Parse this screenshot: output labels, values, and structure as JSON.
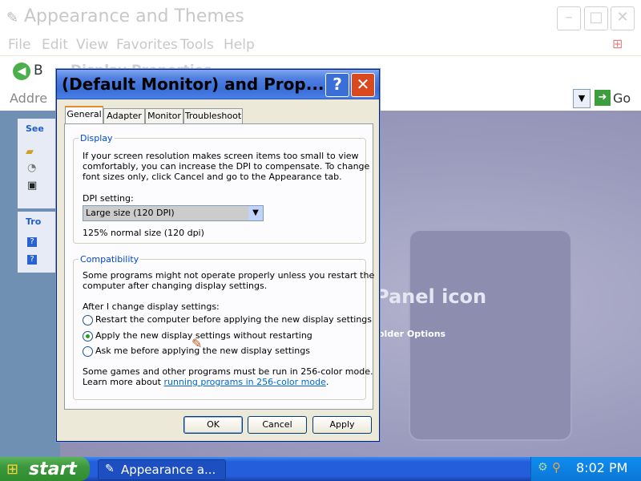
{
  "explorer": {
    "title": "Appearance and Themes",
    "menu": [
      "File",
      "Edit",
      "View",
      "Favorites",
      "Tools",
      "Help"
    ],
    "back_label": "B",
    "address_label": "Addre",
    "go_label": "Go",
    "sidebar_see_label": "See",
    "sidebar_tro_label": "Tro",
    "content_text_1": "Panel icon",
    "content_text_2": "older Options",
    "hidden_window_title": "Display Properties"
  },
  "dialog": {
    "title": "(Default Monitor) and  Prop...",
    "tabs": [
      "General",
      "Adapter",
      "Monitor",
      "Troubleshoot"
    ],
    "display_group": {
      "legend": "Display",
      "description_lines": [
        "If your screen resolution makes screen items too small to view",
        "comfortably, you can increase the DPI to compensate.  To change",
        "font sizes only, click Cancel and go to the Appearance tab."
      ],
      "dpi_label": "DPI setting:",
      "dpi_value": "Large size (120 DPI)",
      "dpi_note": "125% normal size (120 dpi)"
    },
    "compat_group": {
      "legend": "Compatibility",
      "description_lines": [
        "Some programs might not operate properly unless you restart the",
        "computer after changing display settings."
      ],
      "after_label": "After I change display settings:",
      "options": [
        "Restart the computer before applying the new display settings",
        "Apply the new display settings without restarting",
        "Ask me before applying the new display settings"
      ],
      "selected_index": 1,
      "note_line_1": "Some games and other programs must be run in 256-color mode.",
      "note_line_2_prefix": "Learn more about ",
      "note_link": "running programs in 256-color mode",
      "note_suffix": "."
    },
    "buttons": {
      "ok": "OK",
      "cancel": "Cancel",
      "apply": "Apply"
    }
  },
  "taskbar": {
    "start_label": "start",
    "task_label": "Appearance a...",
    "clock": "8:02 PM"
  }
}
